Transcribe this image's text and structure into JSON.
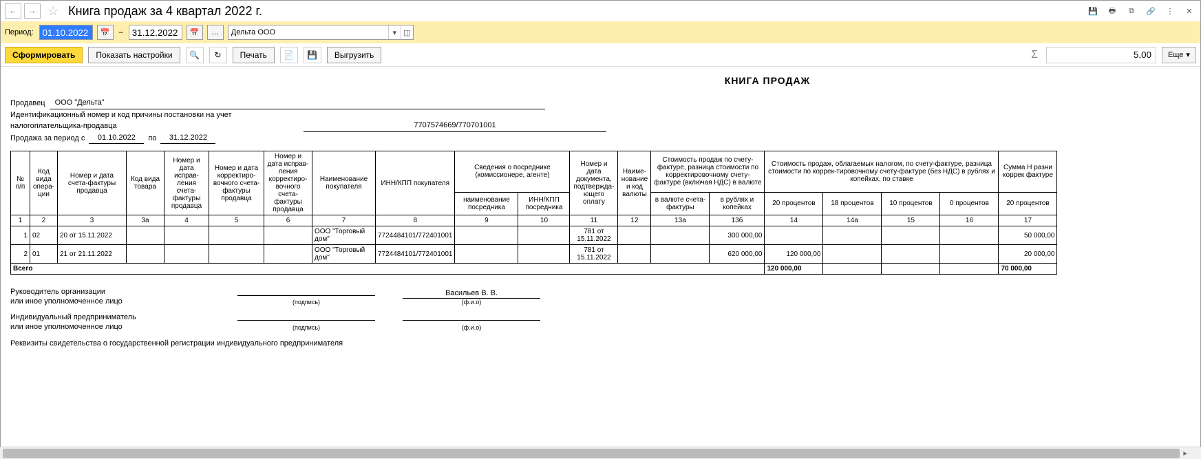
{
  "titlebar": {
    "title": "Книга продаж за 4 квартал 2022 г."
  },
  "period": {
    "label": "Период:",
    "from": "01.10.2022",
    "to": "31.12.2022",
    "org": "Дельта ООО"
  },
  "toolbar": {
    "form": "Сформировать",
    "show_settings": "Показать настройки",
    "print": "Печать",
    "export": "Выгрузить",
    "sum": "5,00",
    "more": "Еще"
  },
  "report": {
    "title": "КНИГА ПРОДАЖ",
    "seller_label": "Продавец",
    "seller_name": "ООО \"Дельта\"",
    "inn_label": "Идентификационный номер и код причины постановки на учет налогоплательщика-продавца",
    "inn_value": "7707574669/770701001",
    "period_label_left": "Продажа за период с",
    "period_from": "01.10.2022",
    "period_mid": "по",
    "period_to": "31.12.2022"
  },
  "headers": {
    "h1": "№ п/п",
    "h2": "Код вида опера-ции",
    "h3": "Номер и дата счета-фактуры продавца",
    "h3a": "Код вида товара",
    "h4": "Номер и дата исправ-ления счета-фактуры продавца",
    "h5": "Номер и дата корректиро-вочного счета-фактуры продавца",
    "h6": "Номер и дата исправ-ления корректиро-вочного счета-фактуры продавца",
    "h7": "Наименование покупателя",
    "h8": "ИНН/КПП покупателя",
    "h9g": "Сведения о посреднике (комиссионере, агенте)",
    "h9": "наименование посредника",
    "h10": "ИНН/КПП посредника",
    "h11": "Номер и дата документа, подтвержда-ющего оплату",
    "h12": "Наиме-нование и код валюты",
    "h13g": "Стоимость продаж по счету-фактуре, разница стоимости по корректировочному счету-фактуре (включая НДС) в валюте",
    "h13a": "в валюте счета-фактуры",
    "h13b": "в рублях и копейках",
    "h14g": "Стоимость продаж, облагаемых налогом, по счету-фактуре, разница стоимости по коррек-тировочному счету-фактуре (без НДС) в рублях и копейках, по ставке",
    "h14": "20 процентов",
    "h14a": "18 процентов",
    "h15": "10 процентов",
    "h16": "0 процентов",
    "h17g": "Сумма Н разни коррек фактуре",
    "h17": "20 процентов"
  },
  "colnums": {
    "c1": "1",
    "c2": "2",
    "c3": "3",
    "c3a": "3а",
    "c4": "4",
    "c5": "5",
    "c6": "6",
    "c7": "7",
    "c8": "8",
    "c9": "9",
    "c10": "10",
    "c11": "11",
    "c12": "12",
    "c13a": "13а",
    "c13b": "13б",
    "c14": "14",
    "c14a": "14а",
    "c15": "15",
    "c16": "16",
    "c17": "17"
  },
  "rows": [
    {
      "n": "1",
      "op": "02",
      "sf": "20 от 15.11.2022",
      "buyer": "ООО \"Торговый дом\"",
      "inn": "7724484101/772401001",
      "doc": "781 от 15.11.2022",
      "rub": "300 000,00",
      "p20": "",
      "p17": "50 000,00"
    },
    {
      "n": "2",
      "op": "01",
      "sf": "21 от 21.11.2022",
      "buyer": "ООО \"Торговый дом\"",
      "inn": "7724484101/772401001",
      "doc": "781 от 15.11.2022",
      "rub": "620 000,00",
      "p20": "120 000,00",
      "p17": "20 000,00"
    }
  ],
  "totals": {
    "label": "Всего",
    "p20": "120 000,00",
    "p17": "70 000,00"
  },
  "signatures": {
    "head_label": "Руководитель организации\nили иное уполномоченное лицо",
    "director_name": "Васильев В. В.",
    "sign_label": "(подпись)",
    "fio_label": "(ф.и.о)",
    "ip_label": "Индивидуальный предприниматель\nили иное уполномоченное лицо",
    "req_label": "Реквизиты свидетельства о государственной регистрации индивидуального предпринимателя"
  }
}
